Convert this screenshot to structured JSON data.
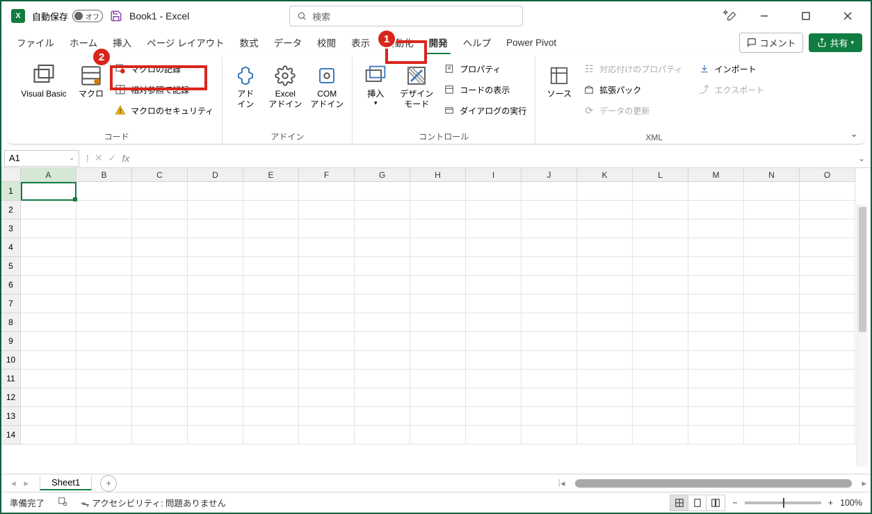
{
  "title": {
    "autosave_label": "自動保存",
    "autosave_state": "オフ",
    "doc_title": "Book1 - Excel",
    "search_placeholder": "検索"
  },
  "ribbon_tabs": [
    "ファイル",
    "ホーム",
    "挿入",
    "ページ レイアウト",
    "数式",
    "データ",
    "校閲",
    "表示",
    "自動化",
    "開発",
    "ヘルプ",
    "Power Pivot"
  ],
  "ribbon_active_index": 9,
  "ribbon_right": {
    "comment": "コメント",
    "share": "共有"
  },
  "callouts": {
    "c1": "1",
    "c2": "2"
  },
  "groups": {
    "code": {
      "visual_basic": "Visual Basic",
      "macros": "マクロ",
      "record_macro": "マクロの記録",
      "relative_ref": "相対参照で記録",
      "macro_security": "マクロのセキュリティ",
      "label": "コード"
    },
    "addins": {
      "addin": "アド\nイン",
      "excel_addin": "Excel\nアドイン",
      "com_addin": "COM\nアドイン",
      "label": "アドイン"
    },
    "controls": {
      "insert": "挿入",
      "design_mode": "デザイン\nモード",
      "properties": "プロパティ",
      "view_code": "コードの表示",
      "run_dialog": "ダイアログの実行",
      "label": "コントロール"
    },
    "xml": {
      "source": "ソース",
      "map_props": "対応付けのプロパティ",
      "expand_pack": "拡張パック",
      "refresh": "データの更新",
      "import": "インポート",
      "export": "エクスポート",
      "label": "XML"
    }
  },
  "formula_bar": {
    "name_box": "A1",
    "fx": "fx"
  },
  "columns": [
    "A",
    "B",
    "C",
    "D",
    "E",
    "F",
    "G",
    "H",
    "I",
    "J",
    "K",
    "L",
    "M",
    "N",
    "O"
  ],
  "rows": [
    "1",
    "2",
    "3",
    "4",
    "5",
    "6",
    "7",
    "8",
    "9",
    "10",
    "11",
    "12",
    "13",
    "14"
  ],
  "sheet_tabs": {
    "sheet1": "Sheet1"
  },
  "statusbar": {
    "ready": "準備完了",
    "accessibility": "アクセシビリティ: 問題ありません",
    "zoom": "100%",
    "minus": "−",
    "plus": "+"
  }
}
